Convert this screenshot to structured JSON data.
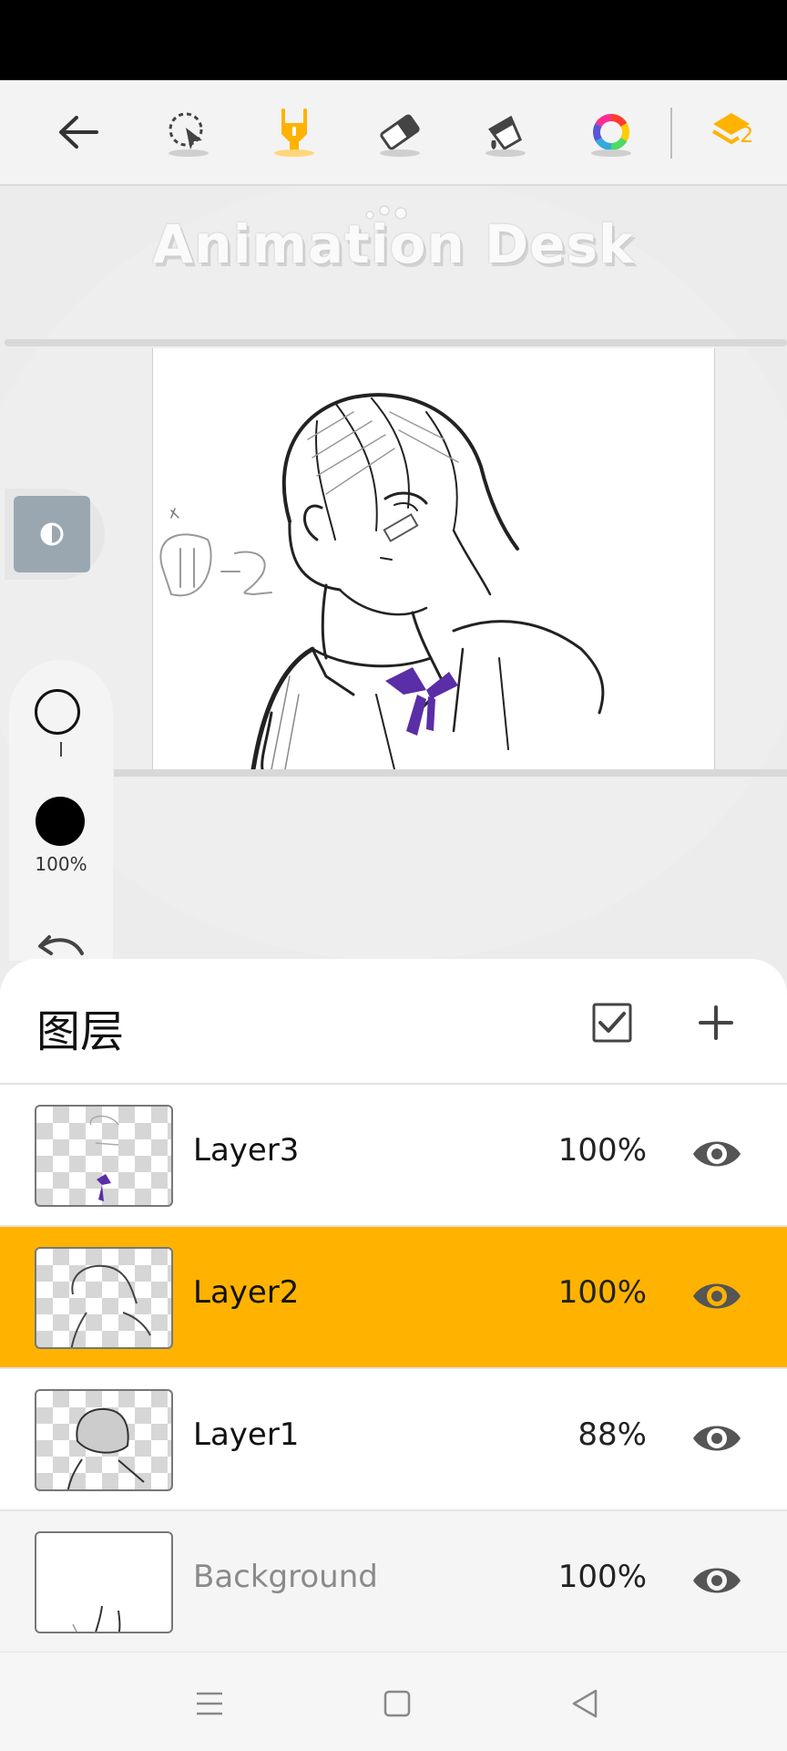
{
  "app": {
    "logo_text": "Animation Desk"
  },
  "toolbar": {
    "tools": [
      {
        "name": "back",
        "icon": "back-arrow-icon"
      },
      {
        "name": "lasso-select",
        "icon": "lasso-select-icon"
      },
      {
        "name": "pen",
        "icon": "pen-icon",
        "active": true
      },
      {
        "name": "eraser",
        "icon": "eraser-icon"
      },
      {
        "name": "fill",
        "icon": "paint-bucket-icon"
      },
      {
        "name": "color-wheel",
        "icon": "color-wheel-icon"
      },
      {
        "name": "layers",
        "icon": "layers-icon",
        "badge": "2"
      }
    ],
    "active_color": "#ffb300"
  },
  "side_panel": {
    "brush_opacity": "100%",
    "brush_color": "#000000"
  },
  "layers_panel": {
    "title": "图层",
    "layers": [
      {
        "name": "Layer3",
        "opacity": "100%",
        "selected": false,
        "visible": true
      },
      {
        "name": "Layer2",
        "opacity": "100%",
        "selected": true,
        "visible": true
      },
      {
        "name": "Layer1",
        "opacity": "88%",
        "selected": false,
        "visible": true
      },
      {
        "name": "Background",
        "opacity": "100%",
        "selected": false,
        "visible": true
      }
    ]
  },
  "colors": {
    "accent": "#ffb300",
    "ribbon": "#5a2ea6"
  }
}
